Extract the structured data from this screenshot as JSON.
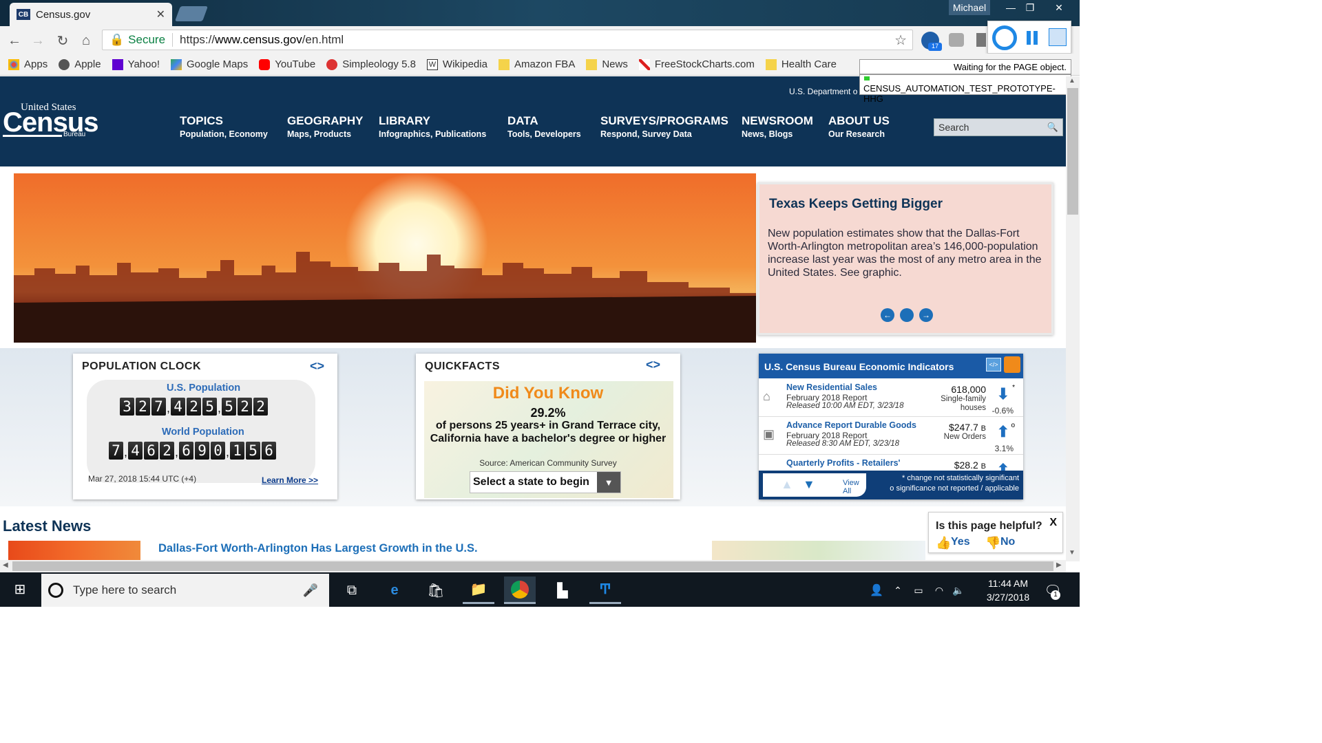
{
  "browser": {
    "tab_title": "Census.gov",
    "tab_favicon": "CB",
    "profile_name": "Michael",
    "secure_label": "Secure",
    "url_prefix": "https://",
    "url_host": "www.census.gov",
    "url_path": "/en.html",
    "extension_badge": "17",
    "bookmarks": [
      {
        "label": "Apps",
        "icon": "apps-grid-icon",
        "color": "#e8453c"
      },
      {
        "label": "Apple",
        "icon": "apple-icon",
        "color": "#555555"
      },
      {
        "label": "Yahoo!",
        "icon": "yahoo-icon",
        "color": "#5f01d1"
      },
      {
        "label": "Google Maps",
        "icon": "maps-icon",
        "color": "#34a853"
      },
      {
        "label": "YouTube",
        "icon": "youtube-icon",
        "color": "#ff0000"
      },
      {
        "label": "Simpleology 5.8",
        "icon": "simpleology-icon",
        "color": "#d33"
      },
      {
        "label": "Wikipedia",
        "icon": "wikipedia-icon",
        "color": "#333333"
      },
      {
        "label": "Amazon FBA",
        "icon": "folder-icon",
        "color": "#f5d34a"
      },
      {
        "label": "News",
        "icon": "folder-icon",
        "color": "#f5d34a"
      },
      {
        "label": "FreeStockCharts.com",
        "icon": "chart-icon",
        "color": "#d22"
      },
      {
        "label": "Health Care",
        "icon": "folder-icon",
        "color": "#f5d34a"
      }
    ],
    "tooltip_status": "Waiting for the PAGE object.",
    "tooltip_name": "CENSUS_AUTOMATION_TEST_PROTOTYPE- HHG"
  },
  "header": {
    "dept_line": "U.S. Department o",
    "logo_top": "United States",
    "logo_main": "Census",
    "logo_bottom": "Bureau",
    "nav": [
      {
        "title": "TOPICS",
        "sub": "Population, Economy"
      },
      {
        "title": "GEOGRAPHY",
        "sub": "Maps, Products"
      },
      {
        "title": "LIBRARY",
        "sub": "Infographics, Publications"
      },
      {
        "title": "DATA",
        "sub": "Tools, Developers"
      },
      {
        "title": "SURVEYS/PROGRAMS",
        "sub": "Respond, Survey Data"
      },
      {
        "title": "NEWSROOM",
        "sub": "News, Blogs"
      },
      {
        "title": "ABOUT US",
        "sub": "Our Research"
      }
    ],
    "search_placeholder": "Search"
  },
  "hero": {
    "headline": "Texas Keeps Getting Bigger",
    "body": "New population estimates show that the Dallas-Fort Worth-Arlington metropolitan area’s 146,000-population increase last year was the most of any metro area in the United States. See graphic."
  },
  "population_clock": {
    "title": "POPULATION CLOCK",
    "us_label": "U.S. Population",
    "us_digits": [
      "3",
      "2",
      "7",
      ",",
      "4",
      "2",
      "5",
      ",",
      "5",
      "2",
      "2"
    ],
    "world_label": "World Population",
    "world_digits": [
      "7",
      ",",
      "4",
      "6",
      "2",
      ",",
      "6",
      "9",
      "0",
      ",",
      "1",
      "5",
      "6"
    ],
    "timestamp": "Mar 27, 2018 15:44 UTC (+4)",
    "learn_more": "Learn More >>"
  },
  "quickfacts": {
    "title": "QUICKFACTS",
    "did_you_know": "Did You Know",
    "percent": "29.2%",
    "description_1": "of persons 25 years+ in Grand Terrace city,",
    "description_2": "California have a bachelor's degree or higher",
    "source": "Source: American Community Survey",
    "select_label": "Select a state to begin"
  },
  "economic_indicators": {
    "title": "U.S. Census Bureau Economic Indicators",
    "rows": [
      {
        "name": "New Residential Sales",
        "report": "February 2018 Report",
        "released": "Released 10:00 AM EDT, 3/23/18",
        "value": "618,000",
        "unit_1": "Single-family",
        "unit_2": "houses",
        "direction": "down",
        "change": "-0.6%",
        "marker": "*"
      },
      {
        "name": "Advance Report Durable Goods",
        "report": "February 2018 Report",
        "released": "Released 8:30 AM EDT, 3/23/18",
        "value": "$247.7",
        "value_suffix": "B",
        "unit_1": "New Orders",
        "unit_2": "",
        "direction": "up",
        "change": "3.1%",
        "marker": "o"
      },
      {
        "name": "Quarterly Profits - Retailers'",
        "value": "$28.2",
        "value_suffix": "B",
        "direction": "up"
      }
    ],
    "view_all": "View All",
    "note_1": "* change not statistically significant",
    "note_2": "o significance not reported / applicable"
  },
  "news": {
    "heading": "Latest News",
    "headline": "Dallas-Fort Worth-Arlington Has Largest Growth in the U.S."
  },
  "feedback": {
    "question": "Is this page helpful?",
    "yes": "Yes",
    "no": "No",
    "close": "X"
  },
  "taskbar": {
    "search_placeholder": "Type here to search",
    "time": "11:44 AM",
    "date": "3/27/2018",
    "notification_count": "1"
  }
}
